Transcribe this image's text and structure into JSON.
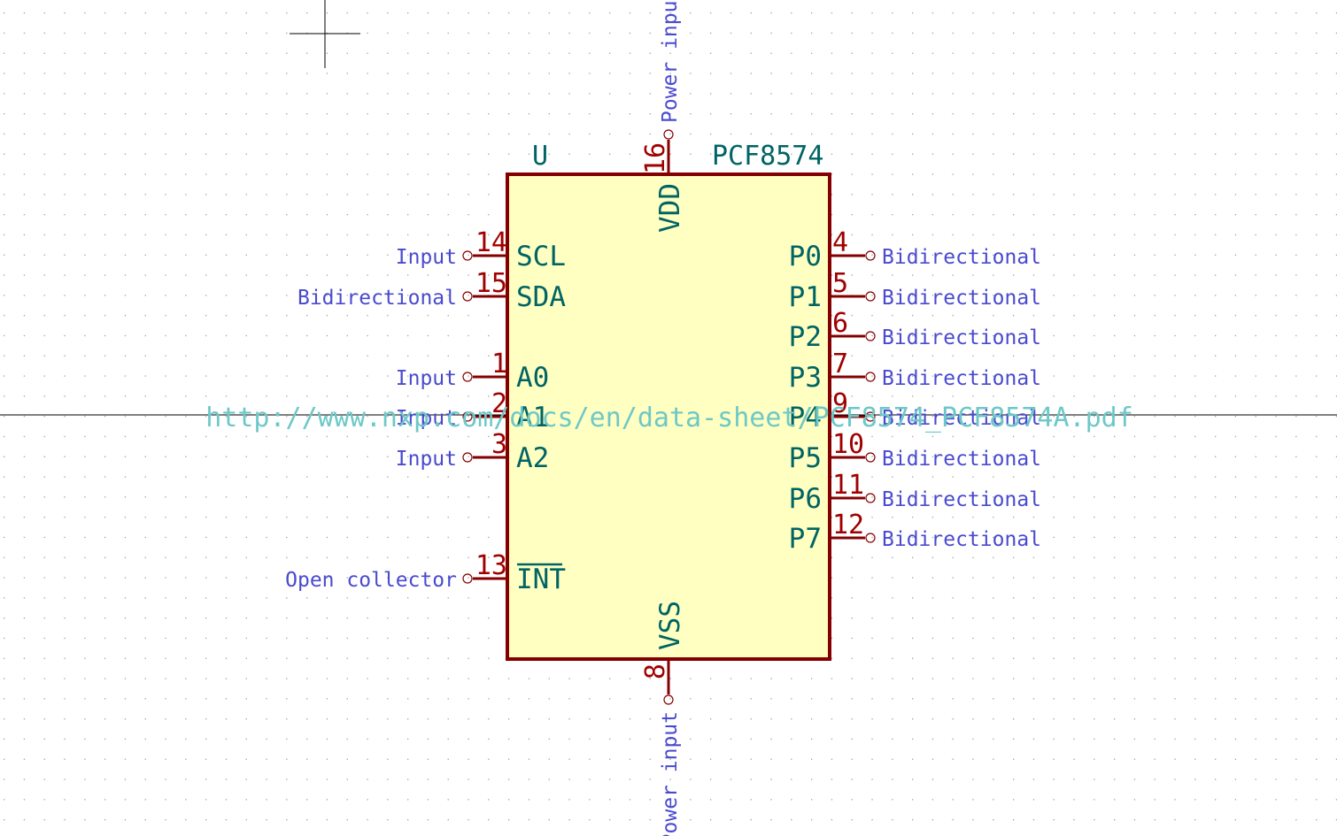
{
  "symbol": {
    "reference": "U",
    "value": "PCF8574",
    "datasheet": "http://www.nxp.com/docs/en/data-sheet/PCF8574_PCF8574A.pdf"
  },
  "pins_left": [
    {
      "number": "14",
      "name": "SCL",
      "type": "Input",
      "overbar": false
    },
    {
      "number": "15",
      "name": "SDA",
      "type": "Bidirectional",
      "overbar": false
    },
    {
      "number": "1",
      "name": "A0",
      "type": "Input",
      "overbar": false
    },
    {
      "number": "2",
      "name": "A1",
      "type": "Input",
      "overbar": false
    },
    {
      "number": "3",
      "name": "A2",
      "type": "Input",
      "overbar": false
    },
    {
      "number": "13",
      "name": "INT",
      "type": "Open collector",
      "overbar": true
    }
  ],
  "pins_right": [
    {
      "number": "4",
      "name": "P0",
      "type": "Bidirectional"
    },
    {
      "number": "5",
      "name": "P1",
      "type": "Bidirectional"
    },
    {
      "number": "6",
      "name": "P2",
      "type": "Bidirectional"
    },
    {
      "number": "7",
      "name": "P3",
      "type": "Bidirectional"
    },
    {
      "number": "9",
      "name": "P4",
      "type": "Bidirectional"
    },
    {
      "number": "10",
      "name": "P5",
      "type": "Bidirectional"
    },
    {
      "number": "11",
      "name": "P6",
      "type": "Bidirectional"
    },
    {
      "number": "12",
      "name": "P7",
      "type": "Bidirectional"
    }
  ],
  "pin_top": {
    "number": "16",
    "name": "VDD",
    "type": "Power input"
  },
  "pin_bottom": {
    "number": "8",
    "name": "VSS",
    "type": "Power input"
  },
  "colors": {
    "background": "#ffffff",
    "grid_dot": "#a0a0a0",
    "body_fill": "#ffffc2",
    "body_stroke": "#840000",
    "pin_line": "#840000",
    "pin_number": "#a00000",
    "pin_name": "#006464",
    "pin_type": "#4a4ad0",
    "field_text": "#006464",
    "datasheet_text": "#6ec8c8",
    "axis": "#000000"
  }
}
